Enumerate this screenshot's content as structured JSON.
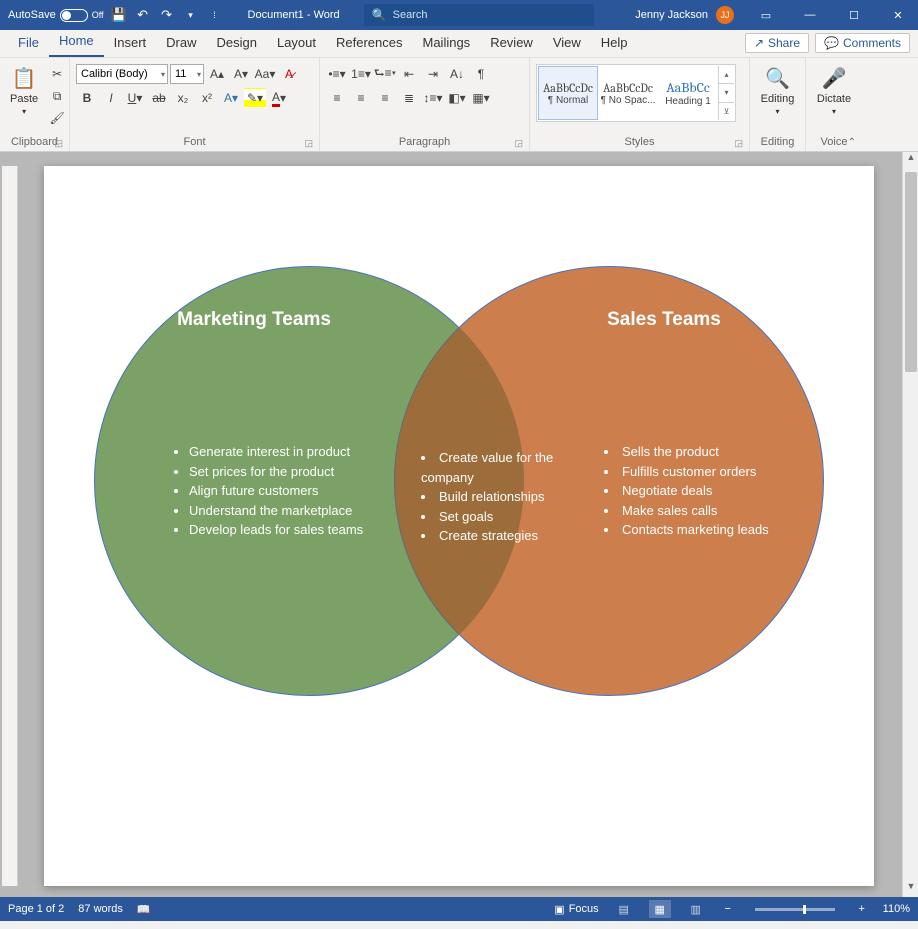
{
  "titlebar": {
    "autosave_label": "AutoSave",
    "autosave_state": "Off",
    "document_title": "Document1 - Word",
    "search_placeholder": "Search",
    "username": "Jenny Jackson",
    "user_initials": "JJ"
  },
  "tabs": {
    "items": [
      "File",
      "Home",
      "Insert",
      "Draw",
      "Design",
      "Layout",
      "References",
      "Mailings",
      "Review",
      "View",
      "Help"
    ],
    "active": "Home",
    "share": "Share",
    "comments": "Comments"
  },
  "ribbon": {
    "clipboard": {
      "label": "Clipboard",
      "paste": "Paste"
    },
    "font": {
      "label": "Font",
      "name": "Calibri (Body)",
      "size": "11"
    },
    "paragraph": {
      "label": "Paragraph"
    },
    "styles": {
      "label": "Styles",
      "items": [
        {
          "preview": "AaBbCcDc",
          "name": "¶ Normal"
        },
        {
          "preview": "AaBbCcDc",
          "name": "¶ No Spac..."
        },
        {
          "preview": "AaBbCc",
          "name": "Heading 1"
        }
      ]
    },
    "editing": {
      "label": "Editing",
      "btn": "Editing"
    },
    "voice": {
      "label": "Voice",
      "btn": "Dictate"
    }
  },
  "venn": {
    "left_title": "Marketing Teams",
    "right_title": "Sales Teams",
    "left_items": [
      "Generate interest in product",
      "Set prices for the product",
      "Align future customers",
      "Understand the marketplace",
      "Develop leads for sales teams"
    ],
    "mid_items": [
      "Create value for the company",
      "Build relationships",
      "Set goals",
      "Create strategies"
    ],
    "right_items": [
      "Sells the product",
      "Fulfills customer orders",
      "Negotiate deals",
      "Make sales calls",
      "Contacts marketing leads"
    ]
  },
  "statusbar": {
    "page": "Page 1 of 2",
    "words": "87 words",
    "focus": "Focus",
    "zoom": "110%"
  }
}
